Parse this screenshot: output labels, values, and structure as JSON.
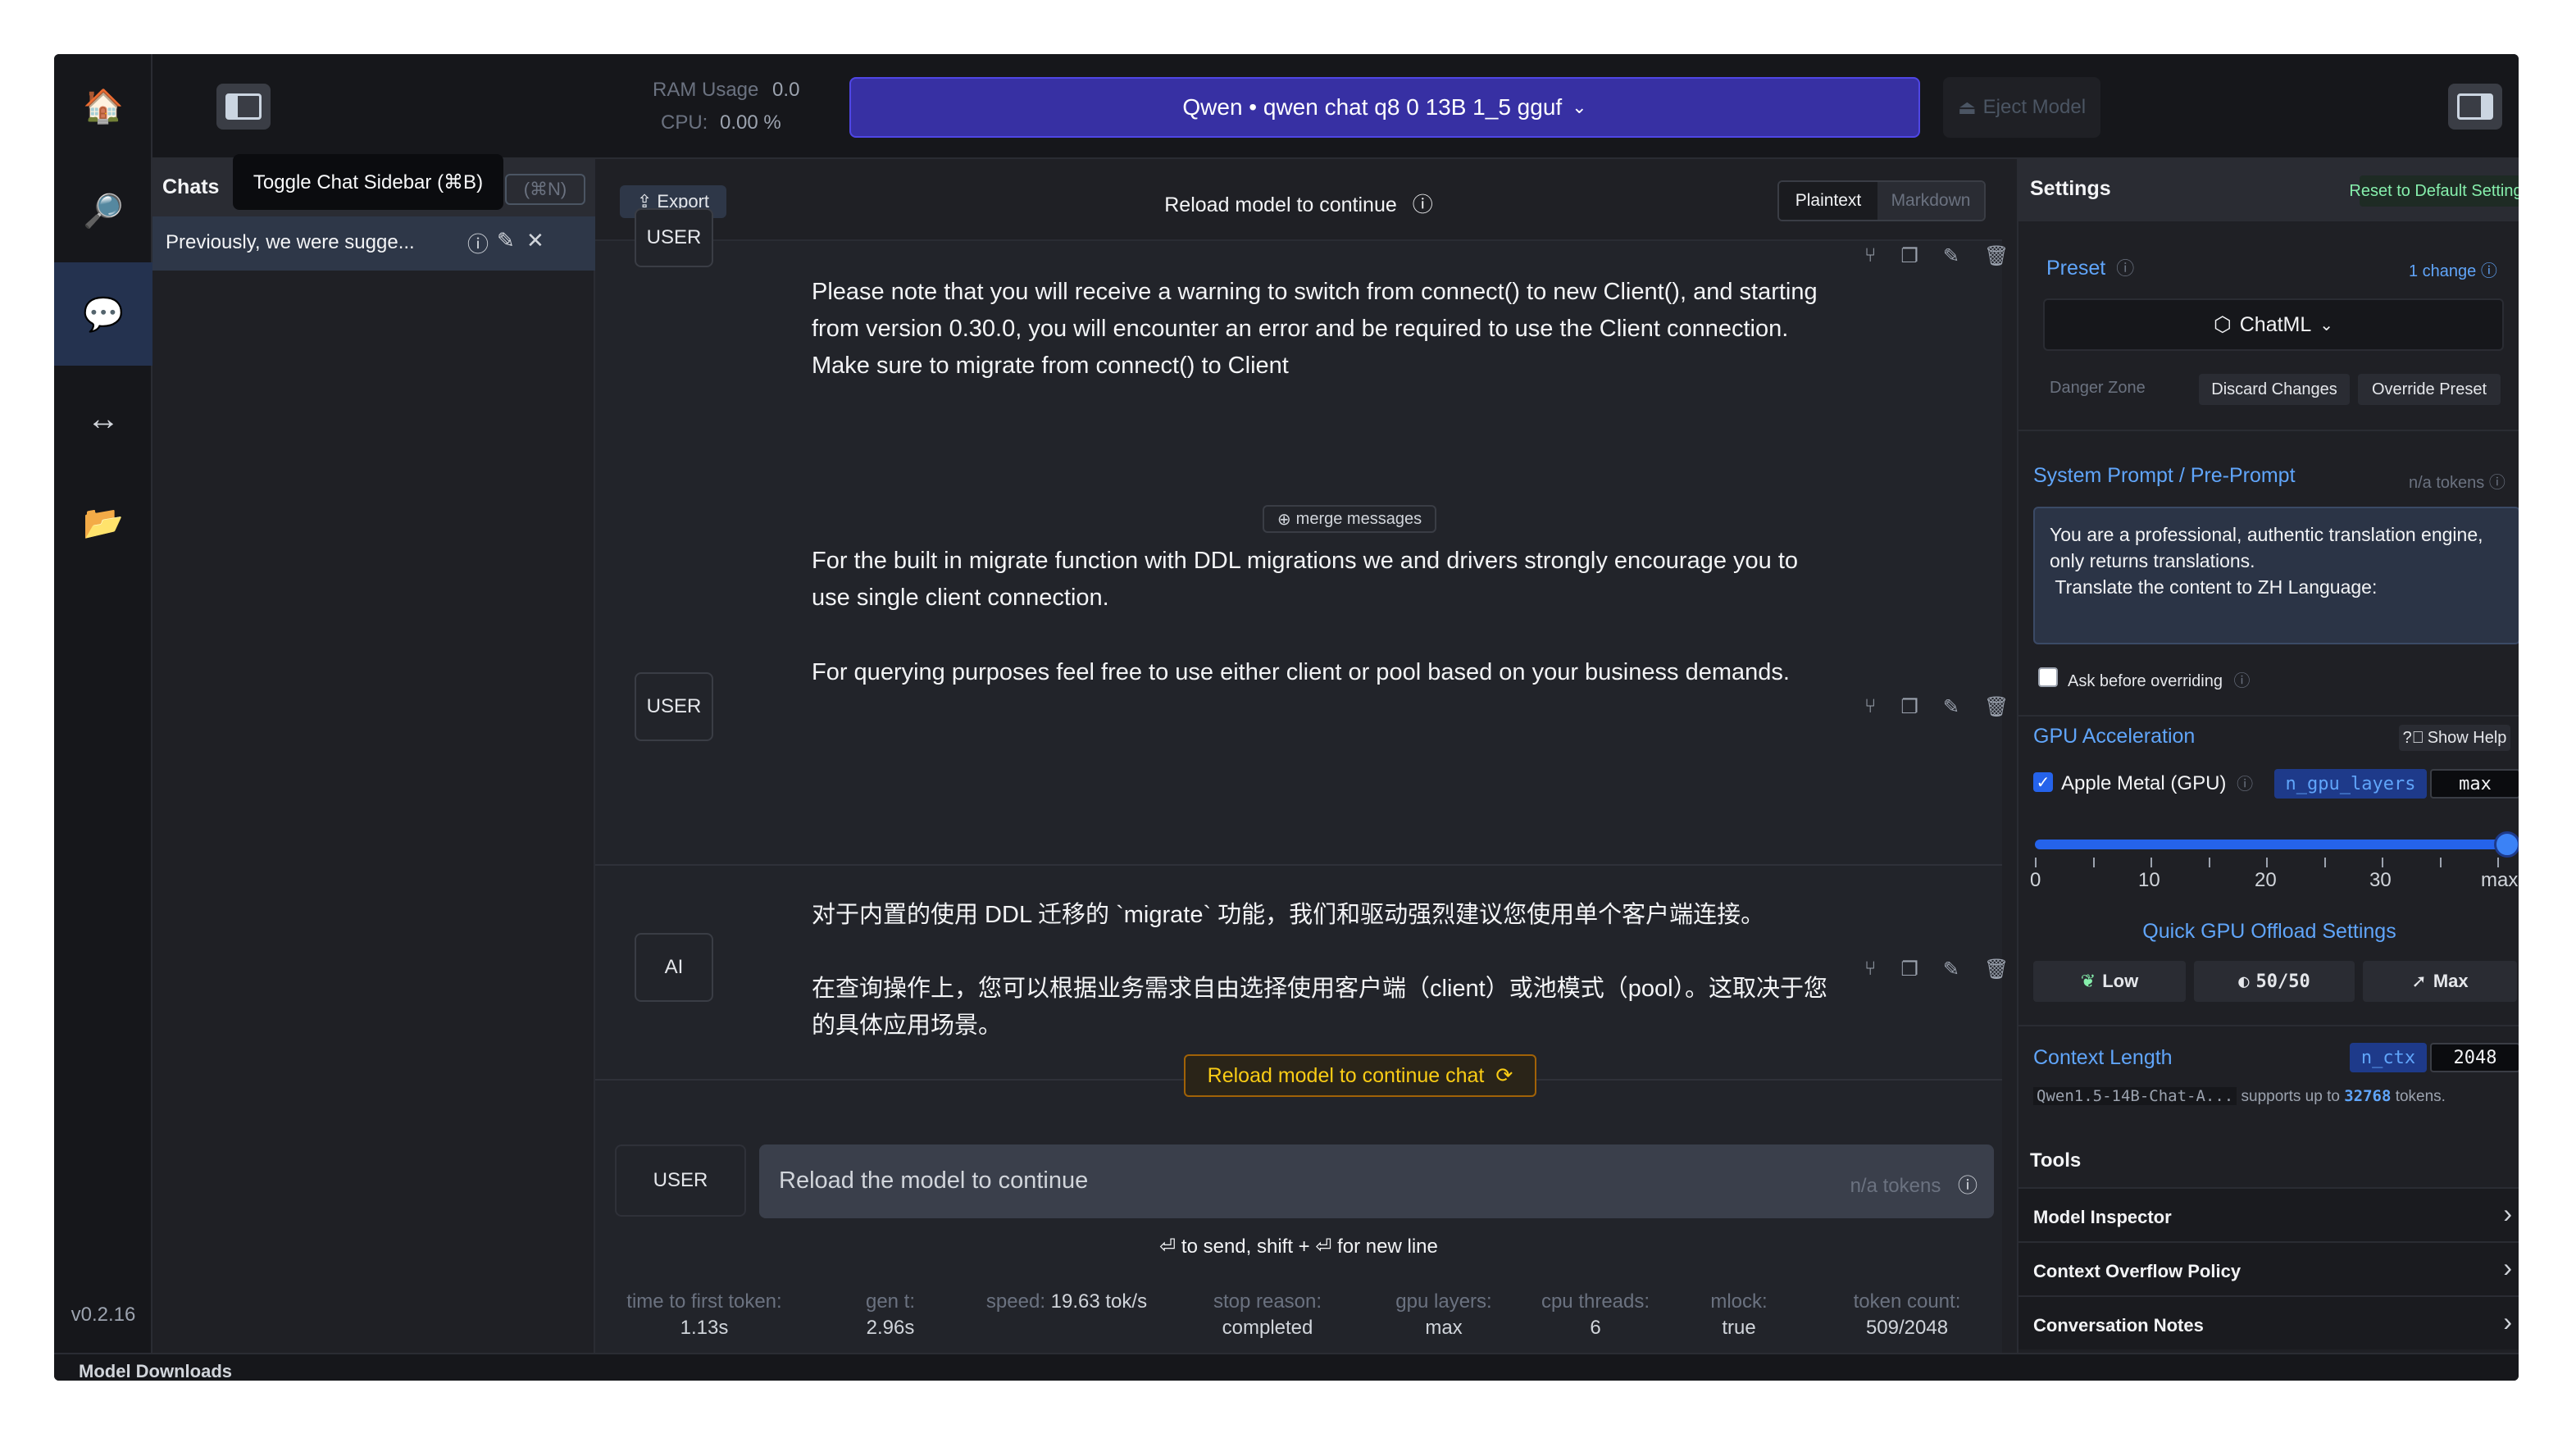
{
  "app": {
    "version": "v0.2.16"
  },
  "rail": {
    "items": [
      {
        "name": "home",
        "icon": "home-icon",
        "glyph": "🏠"
      },
      {
        "name": "search",
        "icon": "search-icon",
        "glyph": "🔎"
      },
      {
        "name": "chat",
        "icon": "chat-icon",
        "glyph": "💬"
      },
      {
        "name": "server",
        "icon": "arrows-icon",
        "glyph": "↔"
      },
      {
        "name": "models",
        "icon": "folder-icon",
        "glyph": "📂"
      }
    ]
  },
  "topbar": {
    "ram_label": "RAM Usage",
    "ram_value": "0.0",
    "cpu_label": "CPU:",
    "cpu_value": "0.00 %",
    "model": "Qwen • qwen chat q8 0 13B 1_5 gguf",
    "eject_label": "Eject Model"
  },
  "chats": {
    "title": "Chats",
    "tooltip": "Toggle Chat Sidebar (⌘B)",
    "new_chat_shortcut": "(⌘N)",
    "items": [
      {
        "title": "Previously, we were sugge..."
      }
    ]
  },
  "main": {
    "export_label": "Export",
    "reload_notice": "Reload model to continue",
    "format_plain": "Plaintext",
    "format_markdown": "Markdown",
    "messages": [
      {
        "role": "USER",
        "text": "Please note that you will receive a warning to switch from connect() to new Client(), and starting from version 0.30.0, you will encounter an error and be required to use the Client connection. Make sure to migrate from connect() to Client"
      },
      {
        "role": "USER",
        "text_p1": "For the built in migrate function with DDL migrations we and drivers strongly encourage you to use single client connection.",
        "text_p2": "For querying purposes feel free to use either client or pool based on your business demands."
      },
      {
        "role": "AI",
        "text_p1": "对于内置的使用 DDL 迁移的 `migrate` 功能，我们和驱动强烈建议您使用单个客户端连接。",
        "text_p2": "在查询操作上，您可以根据业务需求自由选择使用客户端（client）或池模式（pool）。这取决于您的具体应用场景。"
      }
    ],
    "merge_label": "merge messages",
    "reload_chat_label": "Reload model to continue chat",
    "input_role": "USER",
    "input_placeholder": "Reload the model to continue",
    "input_tokens": "n/a tokens",
    "send_hint": "⏎ to send, shift + ⏎ for new line",
    "stats": [
      {
        "label": "time to first token:",
        "value": "1.13s"
      },
      {
        "label": "gen t:",
        "value": "2.96s"
      },
      {
        "label": "speed:",
        "value": "19.63 tok/s"
      },
      {
        "label": "stop reason:",
        "value": "completed"
      },
      {
        "label": "gpu layers:",
        "value": "max"
      },
      {
        "label": "cpu threads:",
        "value": "6"
      },
      {
        "label": "mlock:",
        "value": "true"
      },
      {
        "label": "token count:",
        "value": "509/2048"
      }
    ]
  },
  "settings": {
    "title": "Settings",
    "reset_label": "Reset to Default Settings",
    "preset_label": "Preset",
    "preset_changes": "1 change",
    "preset_value": "ChatML",
    "danger_zone": "Danger Zone",
    "discard_label": "Discard Changes",
    "override_label": "Override Preset",
    "system_prompt_label": "System Prompt / Pre-Prompt",
    "system_prompt_tokens": "n/a tokens",
    "system_prompt": "You are a professional, authentic translation engine, only returns translations.\n Translate the content to ZH Language:",
    "ask_before_overriding": "Ask before overriding",
    "ask_before_overriding_checked": false,
    "gpu_title": "GPU Acceleration",
    "show_help": "Show Help",
    "apple_metal": "Apple Metal (GPU)",
    "apple_metal_checked": true,
    "n_gpu_layers": "n_gpu_layers",
    "n_gpu_layers_value": "max",
    "slider_ticks": [
      "0",
      "10",
      "20",
      "30",
      "max"
    ],
    "quick_offload_title": "Quick GPU Offload Settings",
    "offload_low": "Low",
    "offload_half": "50/50",
    "offload_max": "Max",
    "context_title": "Context Length",
    "n_ctx": "n_ctx",
    "n_ctx_value": "2048",
    "context_model": "Qwen1.5-14B-Chat-A...",
    "context_supports": "supports up to",
    "context_max": "32768",
    "context_tokens_suffix": "tokens.",
    "tools_title": "Tools",
    "tools": [
      "Model Inspector",
      "Context Overflow Policy",
      "Conversation Notes"
    ]
  },
  "downloads": {
    "title": "Model Downloads"
  },
  "colors": {
    "accent": "#3730a3",
    "link": "#60a5fa",
    "warning": "#facc15",
    "success": "#86efac"
  }
}
